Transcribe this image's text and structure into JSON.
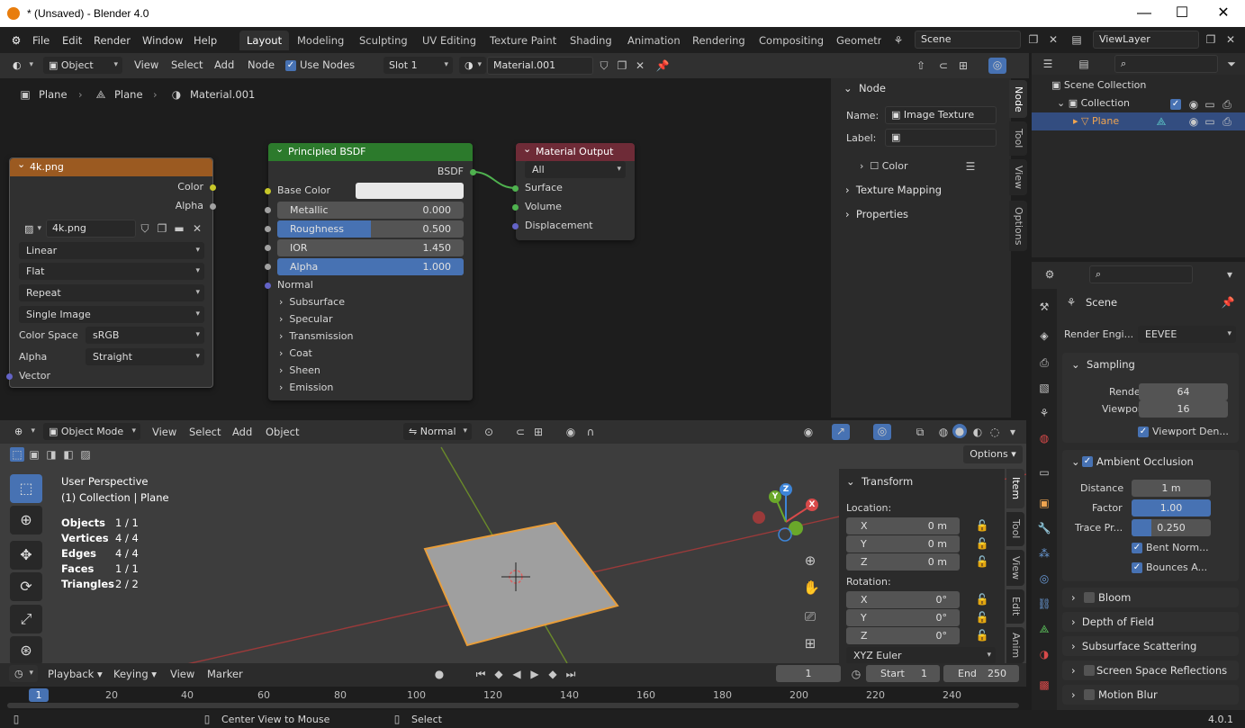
{
  "window": {
    "title": "* (Unsaved) - Blender 4.0",
    "minimize": "—",
    "maximize": "☐",
    "close": "✕"
  },
  "menu": {
    "items": [
      "File",
      "Edit",
      "Render",
      "Window",
      "Help"
    ]
  },
  "workspaces": {
    "tabs": [
      "Layout",
      "Modeling",
      "Sculpting",
      "UV Editing",
      "Texture Paint",
      "Shading",
      "Animation",
      "Rendering",
      "Compositing",
      "Geometry"
    ],
    "active": "Layout"
  },
  "scene": {
    "name": "Scene",
    "view_layer": "ViewLayer"
  },
  "node_header": {
    "object_mode": "Object",
    "view": "View",
    "select": "Select",
    "add": "Add",
    "node": "Node",
    "use_nodes": "Use Nodes",
    "slot": "Slot 1",
    "material": "Material.001"
  },
  "breadcrumb": {
    "items": [
      "Plane",
      "Plane",
      "Material.001"
    ]
  },
  "image_node": {
    "title": "4k.png",
    "out_color": "Color",
    "out_alpha": "Alpha",
    "image": "4k.png",
    "interpolation": "Linear",
    "projection": "Flat",
    "extension": "Repeat",
    "source": "Single Image",
    "color_space_label": "Color Space",
    "color_space": "sRGB",
    "alpha_label": "Alpha",
    "alpha": "Straight",
    "vector": "Vector"
  },
  "bsdf_node": {
    "title": "Principled BSDF",
    "out": "BSDF",
    "base_color": "Base Color",
    "metallic_label": "Metallic",
    "metallic": "0.000",
    "roughness_label": "Roughness",
    "roughness": "0.500",
    "ior_label": "IOR",
    "ior": "1.450",
    "alpha_label": "Alpha",
    "alpha": "1.000",
    "normal": "Normal",
    "panels": [
      "Subsurface",
      "Specular",
      "Transmission",
      "Coat",
      "Sheen",
      "Emission"
    ]
  },
  "output_node": {
    "title": "Material Output",
    "target": "All",
    "surface": "Surface",
    "volume": "Volume",
    "displacement": "Displacement"
  },
  "node_sidebar": {
    "panel": "Node",
    "name_label": "Name:",
    "name": "Image Texture",
    "label_label": "Label:",
    "color": "Color",
    "texture_mapping": "Texture Mapping",
    "properties": "Properties",
    "tabs": [
      "Node",
      "Tool",
      "View",
      "Options"
    ]
  },
  "outliner": {
    "scene_collection": "Scene Collection",
    "collection": "Collection",
    "plane": "Plane"
  },
  "properties": {
    "scene": "Scene",
    "render_engine_label": "Render Engi...",
    "render_engine": "EEVEE",
    "sampling": "Sampling",
    "render_label": "Render",
    "render": "64",
    "viewport_label": "Viewport",
    "viewport": "16",
    "viewport_denoise": "Viewport Den...",
    "ao": "Ambient Occlusion",
    "distance_label": "Distance",
    "distance": "1 m",
    "factor_label": "Factor",
    "factor": "1.00",
    "trace_label": "Trace Pr...",
    "trace": "0.250",
    "bent_normals": "Bent Norm...",
    "bounces": "Bounces A...",
    "bloom": "Bloom",
    "dof": "Depth of Field",
    "sss": "Subsurface Scattering",
    "ssr": "Screen Space Reflections",
    "motion_blur": "Motion Blur"
  },
  "viewport_header": {
    "mode": "Object Mode",
    "view": "View",
    "select": "Select",
    "add": "Add",
    "object": "Object",
    "orientation": "Normal",
    "options": "Options"
  },
  "viewport_info": {
    "perspective": "User Perspective",
    "collection": "(1) Collection | Plane"
  },
  "stats": [
    {
      "label": "Objects",
      "value": "1 / 1"
    },
    {
      "label": "Vertices",
      "value": "4 / 4"
    },
    {
      "label": "Edges",
      "value": "4 / 4"
    },
    {
      "label": "Faces",
      "value": "1 / 1"
    },
    {
      "label": "Triangles",
      "value": "2 / 2"
    }
  ],
  "transform": {
    "title": "Transform",
    "location": "Location:",
    "rotation": "Rotation:",
    "loc": [
      {
        "axis": "X",
        "value": "0 m"
      },
      {
        "axis": "Y",
        "value": "0 m"
      },
      {
        "axis": "Z",
        "value": "0 m"
      }
    ],
    "rot": [
      {
        "axis": "X",
        "value": "0°"
      },
      {
        "axis": "Y",
        "value": "0°"
      },
      {
        "axis": "Z",
        "value": "0°"
      }
    ],
    "mode": "XYZ Euler",
    "tabs": [
      "Item",
      "Tool",
      "View",
      "Edit",
      "Anim"
    ]
  },
  "gizmo": {
    "x": "X",
    "y": "Y",
    "z": "Z"
  },
  "timeline": {
    "playback": "Playback",
    "keying": "Keying",
    "view": "View",
    "marker": "Marker",
    "current_frame": "1",
    "start_label": "Start",
    "start": "1",
    "end_label": "End",
    "end": "250",
    "ruler": [
      "1",
      "20",
      "40",
      "60",
      "80",
      "100",
      "120",
      "140",
      "160",
      "180",
      "200",
      "220",
      "240"
    ]
  },
  "statusbar": {
    "center_view": "Center View to Mouse",
    "select": "Select",
    "version": "4.0.1"
  },
  "colors": {
    "accent": "#4772b3",
    "texture_header": "#9b5a21",
    "shader_header": "#2c7a2c",
    "output_header": "#6e2b37",
    "selection": "#e99e3a"
  }
}
